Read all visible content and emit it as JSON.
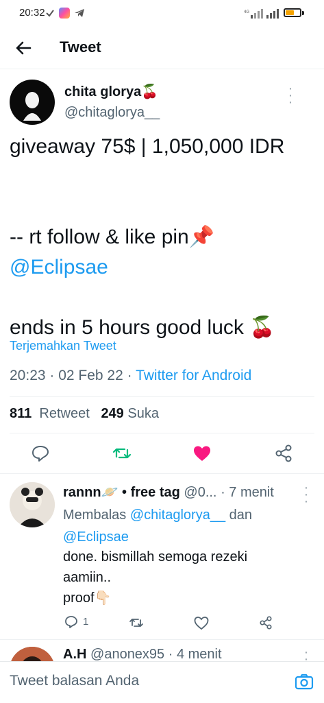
{
  "status_bar": {
    "time": "20:32",
    "left_icons": [
      "checkmark-icon",
      "app-icon",
      "telegram-icon"
    ],
    "right_text": "4G",
    "battery_fraction": 0.6,
    "battery_color": "#f4a300"
  },
  "header": {
    "title": "Tweet"
  },
  "tweet": {
    "author_name": "chita glorya🍒",
    "author_handle": "@chitaglorya__",
    "text_line1": "giveaway 75$ | 1,050,000 IDR",
    "text_line2": "-- rt follow & like pin📌",
    "text_mention": "@Eclipsae",
    "text_line3": "ends in 5 hours good luck 🍒",
    "translate": "Terjemahkan Tweet",
    "timestamp": "20:23 · 02 Feb 22 · ",
    "source": "Twitter for Android",
    "retweets_count": "811",
    "retweets_label": "Retweet",
    "likes_count": "249",
    "likes_label": "Suka",
    "liked": true,
    "accent": "#1d9bf0",
    "like_color": "#f91880",
    "retweet_color": "#00ba7c"
  },
  "replies": [
    {
      "name": "rannn🪐 • free tag",
      "handle": "@0...",
      "time": "· 7 menit",
      "replying_prefix": "Membalas ",
      "replying_user1": "@chitaglorya__",
      "replying_and": " dan ",
      "replying_user2": "@Eclipsae",
      "text": "done. bismillah semoga rezeki\naamiin..\nproof👇🏻",
      "reply_count": "1"
    },
    {
      "name": "A.H",
      "handle": "@anonex95",
      "time": "· 4 menit"
    }
  ],
  "reply_bar": {
    "placeholder": "Tweet balasan Anda"
  }
}
